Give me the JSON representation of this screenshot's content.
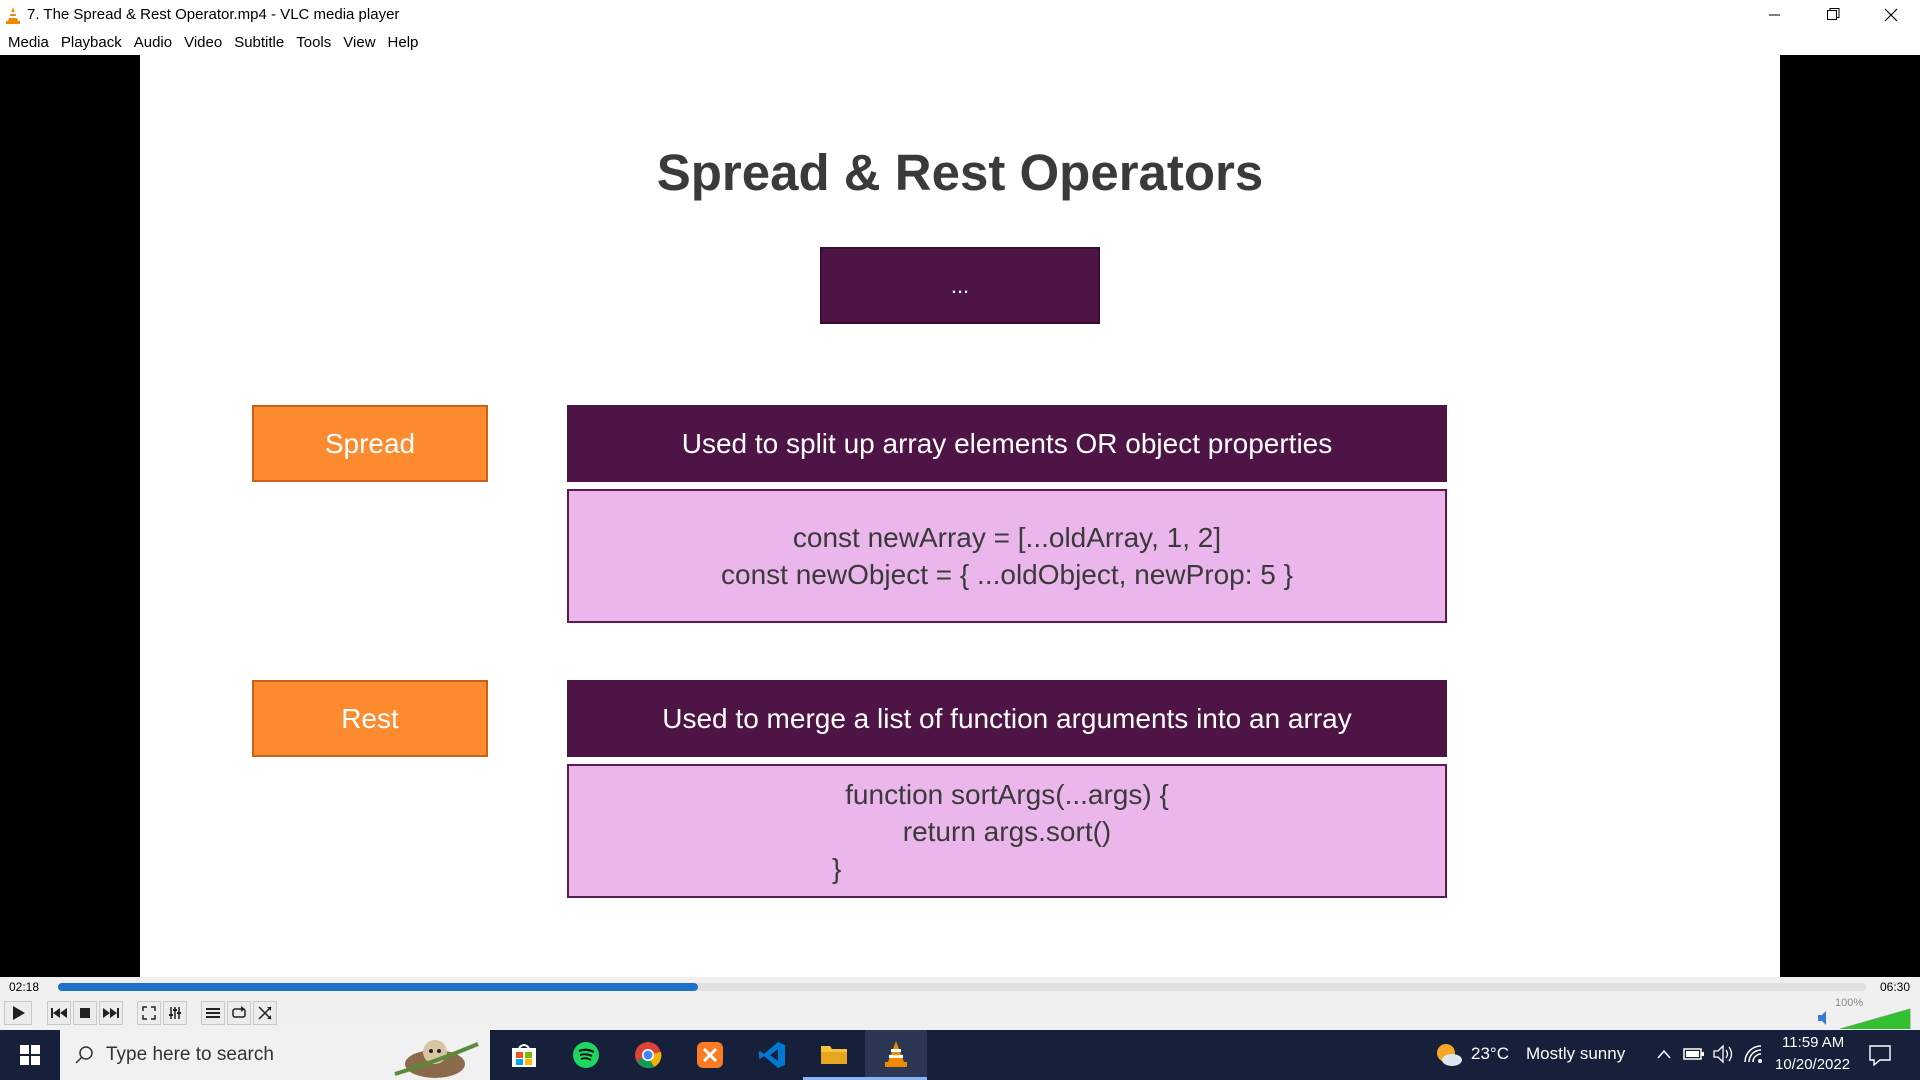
{
  "window": {
    "title": "7. The Spread & Rest Operator.mp4 - VLC media player"
  },
  "menu": [
    "Media",
    "Playback",
    "Audio",
    "Video",
    "Subtitle",
    "Tools",
    "View",
    "Help"
  ],
  "slide": {
    "title": "Spread & Rest Operators",
    "operator": "...",
    "spread": {
      "label": "Spread",
      "description": "Used to split up array elements OR object properties",
      "code": [
        "const newArray = [...oldArray, 1, 2]",
        "const newObject = { ...oldObject, newProp: 5 }"
      ]
    },
    "rest": {
      "label": "Rest",
      "description": "Used to merge a list of function arguments into an array",
      "code": [
        "function sortArgs(...args) {",
        "return args.sort()",
        "}"
      ]
    }
  },
  "player": {
    "current_time": "02:18",
    "total_time": "06:30",
    "progress": 0.354,
    "volume_label": "100%",
    "volume": 1.0
  },
  "taskbar": {
    "search_placeholder": "Type here to search",
    "temperature": "23°C",
    "weather": "Mostly sunny",
    "time": "11:59 AM",
    "date": "10/20/2022"
  },
  "colors": {
    "slide_purple": "#4e1446",
    "slide_orange": "#fd8a2e",
    "slide_pink": "#ebb6eb",
    "seek_blue": "#1d71c9",
    "taskbar_bg": "#16203b"
  }
}
